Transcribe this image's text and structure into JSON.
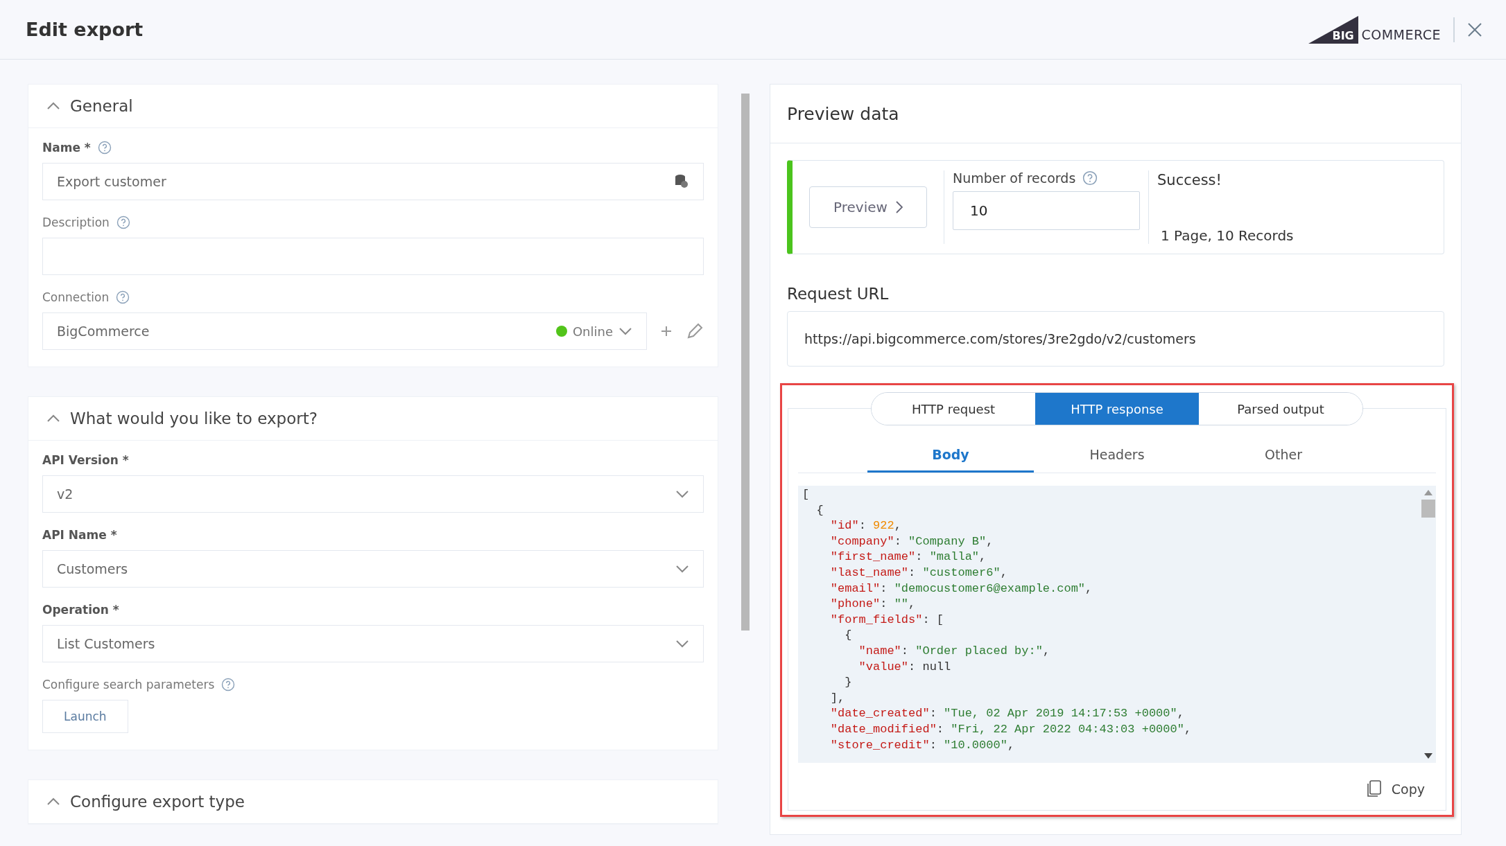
{
  "header": {
    "title": "Edit export",
    "logo": {
      "mark": "BIG",
      "word": "COMMERCE"
    }
  },
  "form": {
    "sections": [
      {
        "title": "General",
        "expanded": true,
        "fields": [
          {
            "kind": "input",
            "label": "Name *",
            "help": true,
            "value": "Export customer"
          },
          {
            "kind": "input",
            "label": "Description",
            "help": true
          },
          {
            "kind": "connection",
            "label": "Connection",
            "help": true,
            "value": "BigCommerce",
            "status": "Online",
            "color": "#52c41a"
          }
        ]
      },
      {
        "title": "What would you like to export?",
        "expanded": true,
        "fields": [
          {
            "kind": "select",
            "label": "API Version *",
            "value": "v2"
          },
          {
            "kind": "select",
            "label": "API Name *",
            "value": "Customers"
          },
          {
            "kind": "select",
            "label": "Operation *",
            "value": "List Customers"
          },
          {
            "kind": "button",
            "label": "Configure search parameters",
            "help": true,
            "value": "Launch"
          }
        ]
      },
      {
        "title": "Configure export type",
        "expanded": true
      }
    ]
  },
  "preview": {
    "title": "Preview data",
    "button": "Preview",
    "records_label": "Number of records",
    "records": "10",
    "status": "Success!",
    "summary": "1 Page, 10 Records",
    "url_label": "Request URL",
    "url": "https://api.bigcommerce.com/stores/3re2gdo/v2/customers",
    "tabs": [
      {
        "label": "HTTP request",
        "selected": false
      },
      {
        "label": "HTTP response",
        "selected": true
      },
      {
        "label": "Parsed output",
        "selected": false
      }
    ],
    "subtabs": [
      {
        "label": "Body",
        "selected": true
      },
      {
        "label": "Headers",
        "selected": false
      },
      {
        "label": "Other",
        "selected": false
      }
    ],
    "code": [
      [
        {
          "kind": "punct",
          "text": "["
        }
      ],
      [
        {
          "kind": "punct",
          "text": "  {"
        }
      ],
      [
        {
          "kind": "key",
          "text": "    \"id\""
        },
        {
          "kind": "punct",
          "text": ": "
        },
        {
          "kind": "number",
          "text": "922"
        },
        {
          "kind": "punct",
          "text": ","
        }
      ],
      [
        {
          "kind": "key",
          "text": "    \"company\""
        },
        {
          "kind": "punct",
          "text": ": "
        },
        {
          "kind": "string",
          "text": "\"Company B\""
        },
        {
          "kind": "punct",
          "text": ","
        }
      ],
      [
        {
          "kind": "key",
          "text": "    \"first_name\""
        },
        {
          "kind": "punct",
          "text": ": "
        },
        {
          "kind": "string",
          "text": "\"malla\""
        },
        {
          "kind": "punct",
          "text": ","
        }
      ],
      [
        {
          "kind": "key",
          "text": "    \"last_name\""
        },
        {
          "kind": "punct",
          "text": ": "
        },
        {
          "kind": "string",
          "text": "\"customer6\""
        },
        {
          "kind": "punct",
          "text": ","
        }
      ],
      [
        {
          "kind": "key",
          "text": "    \"email\""
        },
        {
          "kind": "punct",
          "text": ": "
        },
        {
          "kind": "string",
          "text": "\"democustomer6@example.com\""
        },
        {
          "kind": "punct",
          "text": ","
        }
      ],
      [
        {
          "kind": "key",
          "text": "    \"phone\""
        },
        {
          "kind": "punct",
          "text": ": "
        },
        {
          "kind": "string",
          "text": "\"\""
        },
        {
          "kind": "punct",
          "text": ","
        }
      ],
      [
        {
          "kind": "key",
          "text": "    \"form_fields\""
        },
        {
          "kind": "punct",
          "text": ": ["
        }
      ],
      [
        {
          "kind": "punct",
          "text": "      {"
        }
      ],
      [
        {
          "kind": "key",
          "text": "        \"name\""
        },
        {
          "kind": "punct",
          "text": ": "
        },
        {
          "kind": "string",
          "text": "\"Order placed by:\""
        },
        {
          "kind": "punct",
          "text": ","
        }
      ],
      [
        {
          "kind": "key",
          "text": "        \"value\""
        },
        {
          "kind": "punct",
          "text": ": "
        },
        {
          "kind": "null",
          "text": "null"
        }
      ],
      [
        {
          "kind": "punct",
          "text": "      }"
        }
      ],
      [
        {
          "kind": "punct",
          "text": "    ],"
        }
      ],
      [
        {
          "kind": "key",
          "text": "    \"date_created\""
        },
        {
          "kind": "punct",
          "text": ": "
        },
        {
          "kind": "string",
          "text": "\"Tue, 02 Apr 2019 14:17:53 +0000\""
        },
        {
          "kind": "punct",
          "text": ","
        }
      ],
      [
        {
          "kind": "key",
          "text": "    \"date_modified\""
        },
        {
          "kind": "punct",
          "text": ": "
        },
        {
          "kind": "string",
          "text": "\"Fri, 22 Apr 2022 04:43:03 +0000\""
        },
        {
          "kind": "punct",
          "text": ","
        }
      ],
      [
        {
          "kind": "key",
          "text": "    \"store_credit\""
        },
        {
          "kind": "punct",
          "text": ": "
        },
        {
          "kind": "string",
          "text": "\"10.0000\""
        },
        {
          "kind": "punct",
          "text": ","
        }
      ]
    ],
    "copy": "Copy"
  }
}
